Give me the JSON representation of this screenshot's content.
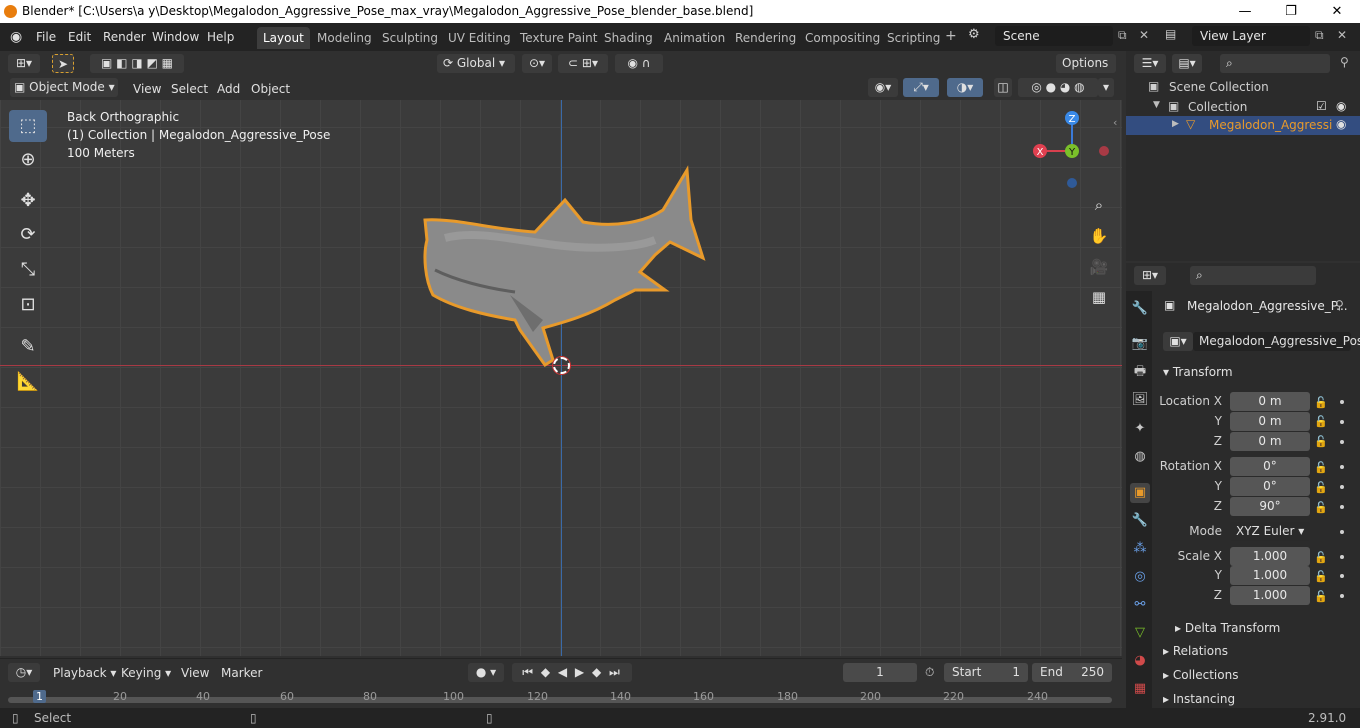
{
  "window": {
    "title": "Blender* [C:\\Users\\a y\\Desktop\\Megalodon_Aggressive_Pose_max_vray\\Megalodon_Aggressive_Pose_blender_base.blend]",
    "minimize": "—",
    "maximize": "❐",
    "close": "✕"
  },
  "menu": {
    "file": "File",
    "edit": "Edit",
    "render": "Render",
    "window": "Window",
    "help": "Help"
  },
  "workspaces": [
    "Layout",
    "Modeling",
    "Sculpting",
    "UV Editing",
    "Texture Paint",
    "Shading",
    "Animation",
    "Rendering",
    "Compositing",
    "Scripting"
  ],
  "scene": {
    "name": "Scene",
    "view_layer": "View Layer"
  },
  "toolbar": {
    "orientation": "Global",
    "options": "Options"
  },
  "viewport_header": {
    "mode": "Object Mode",
    "view": "View",
    "select": "Select",
    "add": "Add",
    "object": "Object"
  },
  "viewport": {
    "projection": "Back Orthographic",
    "collection_line": "(1) Collection | Megalodon_Aggressive_Pose",
    "scale": "100 Meters",
    "gizmo": {
      "z": "Z",
      "y": "Y",
      "x": "X"
    }
  },
  "outliner": {
    "scene_collection": "Scene Collection",
    "collection": "Collection",
    "object": "Megalodon_Aggressi"
  },
  "properties": {
    "object_name": "Megalodon_Aggressive_P...",
    "data_name": "Megalodon_Aggressive_Pose",
    "transform_title": "Transform",
    "location": {
      "label_x": "Location X",
      "label_y": "Y",
      "label_z": "Z",
      "x": "0 m",
      "y": "0 m",
      "z": "0 m"
    },
    "rotation": {
      "label_x": "Rotation X",
      "label_y": "Y",
      "label_z": "Z",
      "x": "0°",
      "y": "0°",
      "z": "90°"
    },
    "mode_label": "Mode",
    "mode": "XYZ Euler",
    "scale": {
      "label_x": "Scale X",
      "label_y": "Y",
      "label_z": "Z",
      "x": "1.000",
      "y": "1.000",
      "z": "1.000"
    },
    "delta_transform": "Delta Transform",
    "relations": "Relations",
    "collections": "Collections",
    "instancing": "Instancing"
  },
  "timeline": {
    "playback": "Playback",
    "keying": "Keying",
    "view": "View",
    "marker": "Marker",
    "current_frame": "1",
    "start_label": "Start",
    "start": "1",
    "end_label": "End",
    "end": "250",
    "ticks": [
      "1",
      "20",
      "40",
      "60",
      "80",
      "100",
      "120",
      "140",
      "160",
      "180",
      "200",
      "220",
      "240"
    ]
  },
  "status": {
    "select": "Select",
    "version": "2.91.0"
  },
  "colors": {
    "accent_blue": "#4f6a8c",
    "selection_orange": "#e89a2b",
    "axis_red": "#a83a45",
    "axis_blue": "#3a6aa8"
  }
}
